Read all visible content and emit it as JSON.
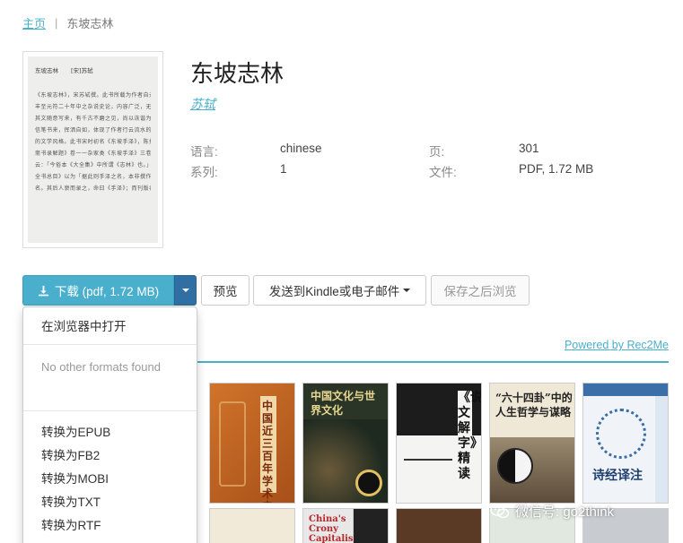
{
  "breadcrumb": {
    "home": "主页",
    "separator": "|",
    "current": "东坡志林"
  },
  "book": {
    "title": "东坡志林",
    "author": "苏轼",
    "cover": {
      "header_left": "东坡志林",
      "header_right": "[宋]苏轼",
      "lines": [
        "《东坡志林》，宋苏轼撰。此书所载为作者自元",
        "丰至元符二十年中之杂说史论，内容广泛，无所不载。",
        "其文随意写来，有千古不磨之见，尚以诙谐为多。皆",
        "信笔书来，挥洒自如，体现了作者行云流水的笔风和",
        "的文学风格。此书宋时初名《东坡手泽》，陈振孙《直",
        "斋书录解题》卷一一杂家类《东坡手泽》三卷，并注",
        "云：「今俗本《大全集》中所谓《志林》也。」《四库",
        "全书总目》以为「据此则手泽之名，本非撰作，亦无书",
        "名。其后人裒而录之，命曰《手泽》；而刊版者多不"
      ]
    }
  },
  "properties": {
    "language_label": "语言:",
    "language_value": "chinese",
    "series_label": "系列:",
    "series_value": "1",
    "pages_label": "页:",
    "pages_value": "301",
    "file_label": "文件:",
    "file_value": "PDF, 1.72 MB"
  },
  "buttons": {
    "download": "下载 (pdf, 1.72 MB)",
    "preview": "预览",
    "send": "发送到Kindle或电子邮件",
    "save": "保存之后浏览"
  },
  "dropdown": {
    "open_browser": "在浏览器中打开",
    "no_formats": "No other formats found",
    "convert": [
      "转换为EPUB",
      "转换为FB2",
      "转换为MOBI",
      "转换为TXT",
      "转换为RTF"
    ]
  },
  "recommendations": {
    "powered_by": "Powered by Rec2Me",
    "books": [
      {
        "title": "中国近三百年学术史",
        "color": "#c0641f"
      },
      {
        "title": "中国文化与世界文化",
        "color": "#2d3a30"
      },
      {
        "title": "《说文解字》精读",
        "color": "#f2f2f0"
      },
      {
        "title": "“六十四卦”中的人生哲学与谋略",
        "color": "#e6e0d0"
      },
      {
        "title": "诗经译注",
        "color": "#e8eef5"
      }
    ],
    "bottom_titles": [
      "China's Crony Capitalism"
    ]
  },
  "watermark": {
    "text": "微信号: go2think"
  },
  "colors": {
    "accent": "#49afcd",
    "dark_accent": "#2f6fa4"
  }
}
